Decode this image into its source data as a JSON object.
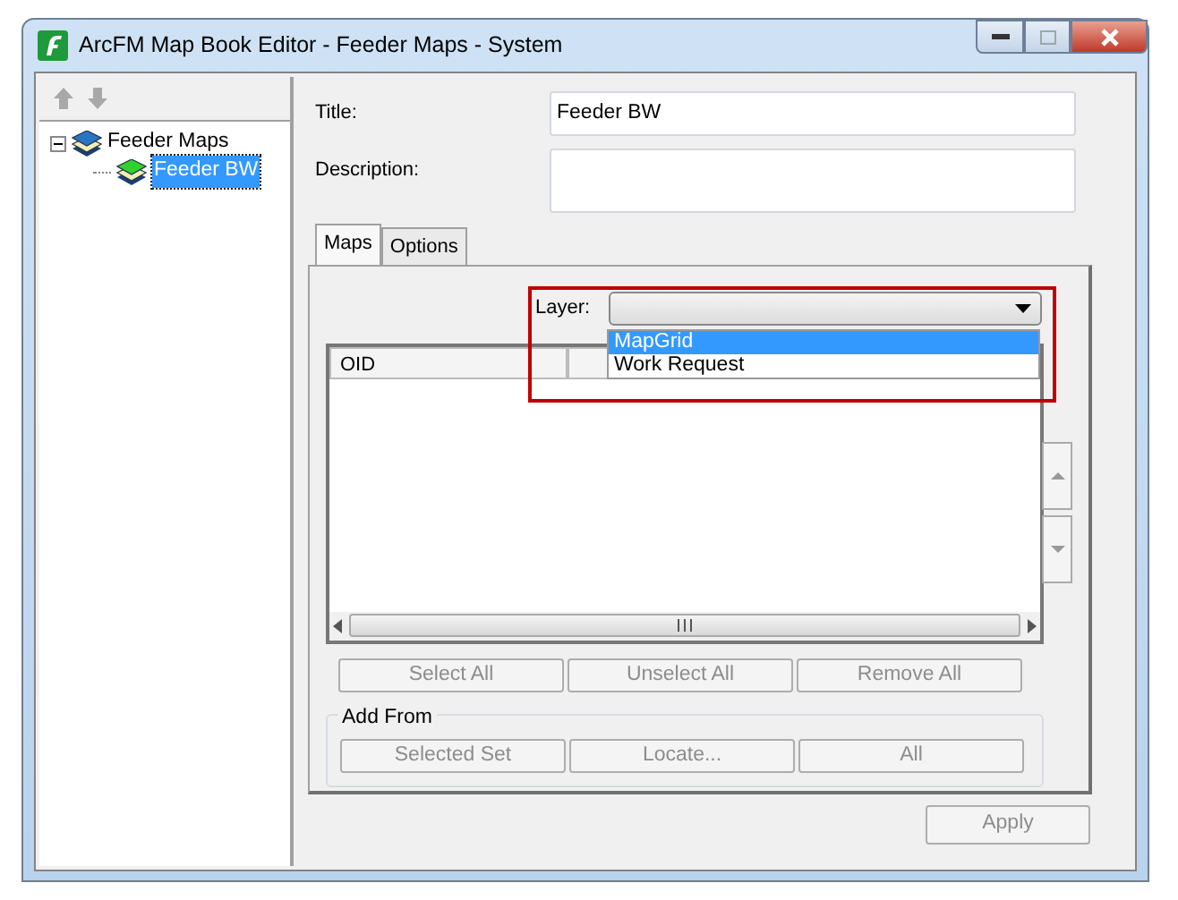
{
  "window": {
    "title": "ArcFM Map Book Editor - Feeder Maps - System"
  },
  "tree": [
    {
      "label": "Feeder Maps",
      "expanded": true,
      "selected": false,
      "children": [
        {
          "label": "Feeder BW",
          "selected": true
        }
      ]
    }
  ],
  "form": {
    "title_label": "Title:",
    "title_value": "Feeder BW",
    "description_label": "Description:"
  },
  "tabs": [
    {
      "label": "Maps",
      "selected": true
    },
    {
      "label": "Options",
      "selected": false
    }
  ],
  "layer": {
    "label": "Layer:",
    "options": [
      {
        "label": "MapGrid",
        "selected": true
      },
      {
        "label": "Work Request",
        "selected": false
      }
    ]
  },
  "table": {
    "columns": [
      "OID"
    ]
  },
  "buttons": [
    {
      "label": "Select All",
      "disabled": true
    },
    {
      "label": "Unselect All",
      "disabled": true
    },
    {
      "label": "Remove All",
      "disabled": true
    }
  ],
  "add_from": {
    "label": "Add From",
    "buttons": [
      {
        "label": "Selected Set",
        "disabled": true
      },
      {
        "label": "Locate...",
        "disabled": true
      },
      {
        "label": "All",
        "disabled": true
      }
    ]
  },
  "apply": {
    "label": "Apply",
    "disabled": true
  }
}
